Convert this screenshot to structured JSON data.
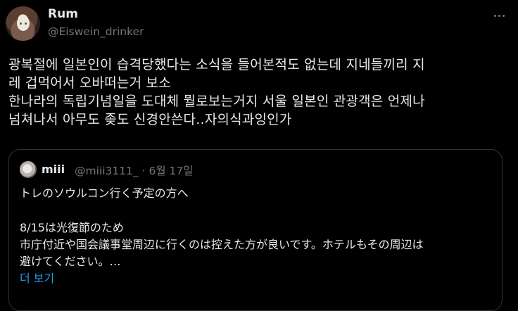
{
  "author": {
    "name": "Rum",
    "handle": "@Eiswein_drinker"
  },
  "tweet": {
    "lines": [
      "광복절에 일본인이 습격당했다는 소식을 들어본적도 없는데 지네들끼리 지",
      "레 겁먹어서 오바떠는거 보소",
      "한나라의 독립기념일을 도대체 뭘로보는거지 서울 일본인 관광객은 언제나",
      "넘쳐나서 아무도 좆도 신경안쓴다..자의식과잉인가"
    ]
  },
  "quoted_tweet": {
    "name": "miii",
    "meta": "@miii3111_ · 6월 17일",
    "lines": [
      "トレのソウルコン行く予定の方へ",
      "",
      "8/15は光復節のため",
      "市庁付近や国会議事堂周辺に行くのは控えた方が良いです。ホテルもその周辺は",
      "避けてください。…"
    ],
    "show_more": "더 보기"
  },
  "icons": {
    "more": "more-horizontal-icon"
  },
  "colors": {
    "background": "#000000",
    "text": "#e7e9ea",
    "secondary": "#71767b",
    "link": "#1d9bf0",
    "border": "#2f3336"
  }
}
